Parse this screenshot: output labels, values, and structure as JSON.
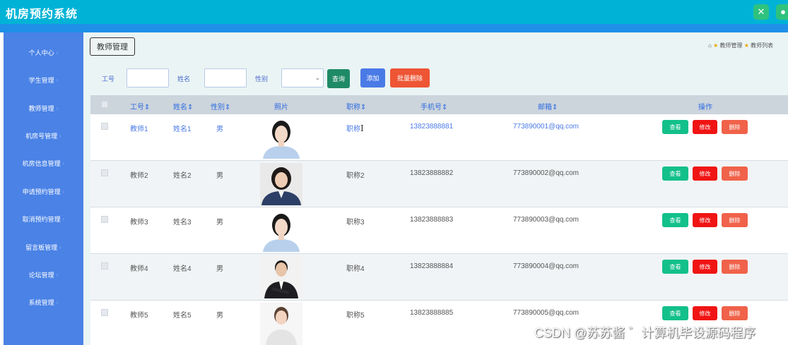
{
  "app": {
    "title": "机房预约系统"
  },
  "sidebar": {
    "items": [
      {
        "label": "个人中心"
      },
      {
        "label": "学生管理"
      },
      {
        "label": "教师管理"
      },
      {
        "label": "机房号管理"
      },
      {
        "label": "机房信息管理"
      },
      {
        "label": "申请预约管理"
      },
      {
        "label": "取消预约管理"
      },
      {
        "label": "留言板管理"
      },
      {
        "label": "论坛管理"
      },
      {
        "label": "系统管理"
      }
    ]
  },
  "content": {
    "tab_label": "教师管理",
    "breadcrumb": [
      "教师管理",
      "教师列表"
    ]
  },
  "filters": {
    "employee_no_label": "工号",
    "name_label": "姓名",
    "gender_label": "性别",
    "employee_no_value": "",
    "name_value": "",
    "gender_value": ""
  },
  "buttons": {
    "query": "查询",
    "add": "添加",
    "batch_delete": "批量删除"
  },
  "table": {
    "headers": {
      "employee_no": "工号",
      "name": "姓名",
      "gender": "性别",
      "photo": "照片",
      "title": "职称",
      "phone": "手机号",
      "email": "邮箱",
      "actions": "操作"
    },
    "sort_glyph": "⇕",
    "rows": [
      {
        "employee_no": "教师1",
        "name": "姓名1",
        "gender": "男",
        "title": "职称",
        "phone": "13823888881",
        "email": "773890001@qq.com",
        "photo": "woman-white-shirt"
      },
      {
        "employee_no": "教师2",
        "name": "姓名2",
        "gender": "男",
        "title": "职称2",
        "phone": "13823888882",
        "email": "773890002@qq.com",
        "photo": "woman-dark-suit"
      },
      {
        "employee_no": "教师3",
        "name": "姓名3",
        "gender": "男",
        "title": "职称3",
        "phone": "13823888883",
        "email": "773890003@qq.com",
        "photo": "woman-white-shirt"
      },
      {
        "employee_no": "教师4",
        "name": "姓名4",
        "gender": "男",
        "title": "职称4",
        "phone": "13823888884",
        "email": "773890004@qq.com",
        "photo": "man-dark-suit"
      },
      {
        "employee_no": "教师5",
        "name": "姓名5",
        "gender": "男",
        "title": "职称5",
        "phone": "13823888885",
        "email": "773890005@qq.com",
        "photo": "woman-white-dress"
      }
    ],
    "row_actions": {
      "view": "查看",
      "edit": "修改",
      "delete": "删除"
    }
  },
  "watermark": "CSDN @苏苏酱 ゛计算机毕设源码程序",
  "colors": {
    "topbar": "#00b3d6",
    "sidebar": "#4a82e6",
    "content_bg": "#eaf4f4",
    "view": "#13c08a",
    "edit": "#f01414",
    "delete": "#f0624a"
  }
}
